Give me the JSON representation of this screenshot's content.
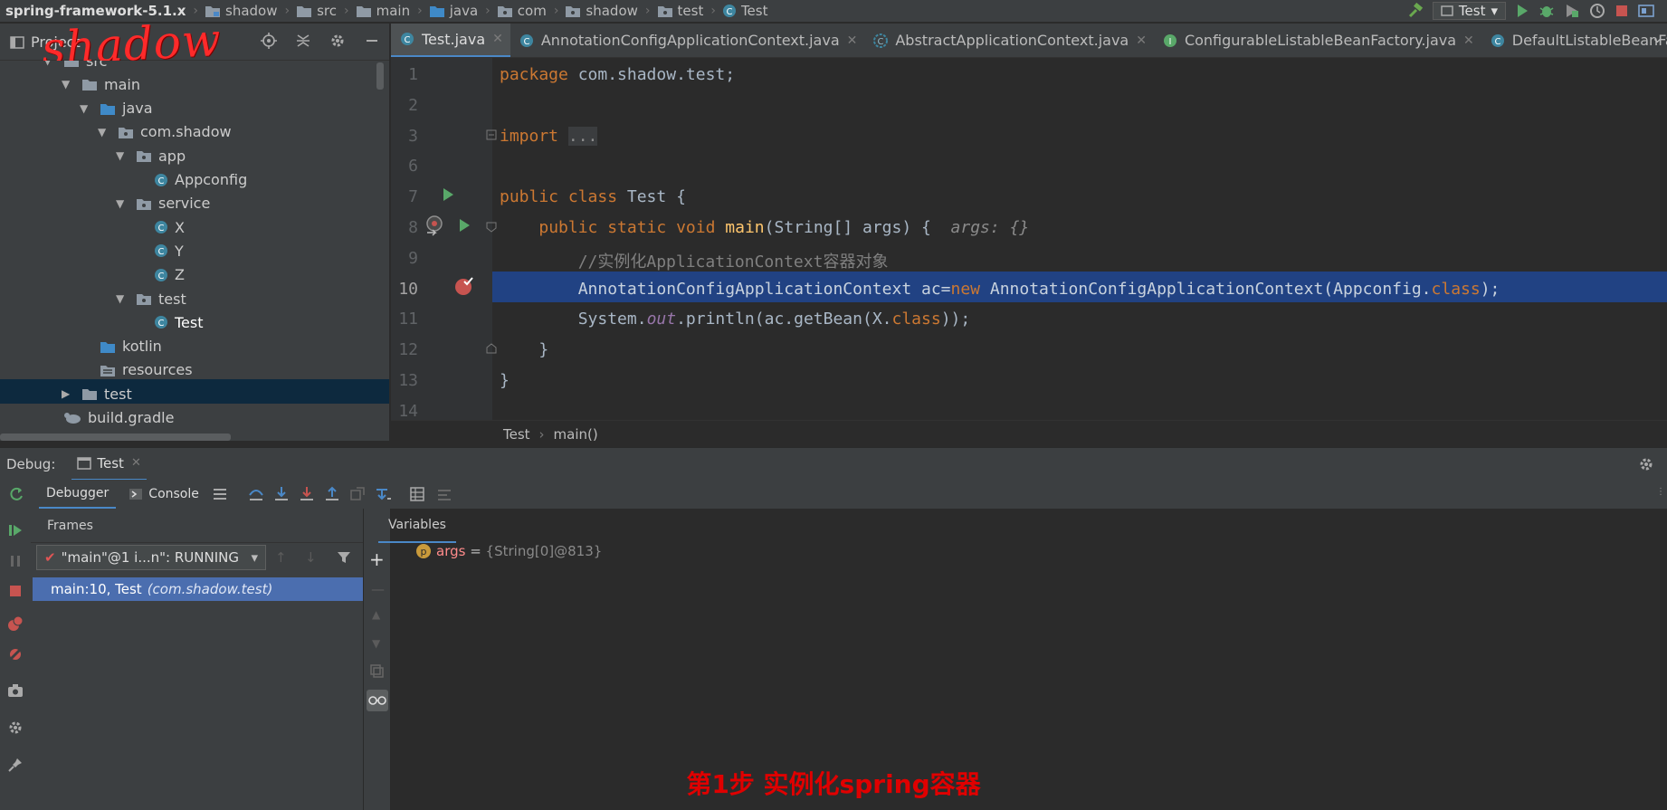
{
  "breadcrumb": [
    {
      "label": "spring-framework-5.1.x",
      "icon": "none"
    },
    {
      "label": "shadow",
      "icon": "module-folder-icon"
    },
    {
      "label": "src",
      "icon": "folder-icon"
    },
    {
      "label": "main",
      "icon": "folder-icon"
    },
    {
      "label": "java",
      "icon": "source-folder-icon"
    },
    {
      "label": "com",
      "icon": "package-icon"
    },
    {
      "label": "shadow",
      "icon": "package-icon"
    },
    {
      "label": "test",
      "icon": "package-icon"
    },
    {
      "label": "Test",
      "icon": "class-icon"
    }
  ],
  "run_config": {
    "label": "Test"
  },
  "project_panel": {
    "title": "Project",
    "logo_text": "shadow"
  },
  "tabs": [
    {
      "label": "Test.java",
      "icon": "class-icon",
      "active": true
    },
    {
      "label": "AnnotationConfigApplicationContext.java",
      "icon": "class-icon"
    },
    {
      "label": "AbstractApplicationContext.java",
      "icon": "abstract-class-icon"
    },
    {
      "label": "ConfigurableListableBeanFactory.java",
      "icon": "interface-icon"
    },
    {
      "label": "DefaultListableBeanFactory.java",
      "icon": "class-icon"
    }
  ],
  "tree": [
    {
      "label": "src",
      "depth": 0,
      "expanded": true,
      "icon": "folder-icon"
    },
    {
      "label": "main",
      "depth": 1,
      "expanded": true,
      "icon": "folder-icon"
    },
    {
      "label": "java",
      "depth": 2,
      "expanded": true,
      "icon": "source-folder-icon"
    },
    {
      "label": "com.shadow",
      "depth": 3,
      "expanded": true,
      "icon": "package-icon"
    },
    {
      "label": "app",
      "depth": 4,
      "expanded": true,
      "icon": "package-icon"
    },
    {
      "label": "Appconfig",
      "depth": 5,
      "icon": "class-icon"
    },
    {
      "label": "service",
      "depth": 4,
      "expanded": true,
      "icon": "package-icon"
    },
    {
      "label": "X",
      "depth": 5,
      "icon": "class-icon"
    },
    {
      "label": "Y",
      "depth": 5,
      "icon": "class-icon"
    },
    {
      "label": "Z",
      "depth": 5,
      "icon": "class-icon"
    },
    {
      "label": "test",
      "depth": 4,
      "expanded": true,
      "icon": "package-icon"
    },
    {
      "label": "Test",
      "depth": 5,
      "icon": "class-icon",
      "selected": true
    },
    {
      "label": "kotlin",
      "depth": 2,
      "icon": "source-folder-icon"
    },
    {
      "label": "resources",
      "depth": 2,
      "icon": "resources-folder-icon"
    },
    {
      "label": "test",
      "depth": 1,
      "expanded": false,
      "icon": "folder-icon"
    },
    {
      "label": "build.gradle",
      "depth": 0,
      "icon": "gradle-icon"
    }
  ],
  "editor": {
    "lines": [
      {
        "num": "1",
        "html": "<span class=\"kw\">package</span> com.shadow.test;"
      },
      {
        "num": "2",
        "html": ""
      },
      {
        "num": "3",
        "html": "<span class=\"kw\">import</span> <span class=\"fold\">...</span>"
      },
      {
        "num": "6",
        "html": ""
      },
      {
        "num": "7",
        "html": "<span class=\"kw\">public class</span> Test {"
      },
      {
        "num": "8",
        "html": "    <span class=\"kw\">public static void</span> <span style=\"color:#ffc66d\">main</span>(String[] args) {  <span class=\"ph\">args: {}</span>"
      },
      {
        "num": "9",
        "html": "        <span class=\"cm\">//实例化ApplicationContext容器对象</span>"
      },
      {
        "num": "10",
        "html": "        AnnotationConfigApplicationContext ac=<span class=\"kw\">new</span> AnnotationConfigApplicationContext(Appconfig.<span class=\"kw\">class</span>);"
      },
      {
        "num": "11",
        "html": "        System.<span class=\"it\">out</span>.println(ac.getBean(X.<span class=\"kw\">class</span>));"
      },
      {
        "num": "12",
        "html": "    }"
      },
      {
        "num": "13",
        "html": "}"
      },
      {
        "num": "14",
        "html": ""
      }
    ],
    "current_line": "10",
    "crumb": [
      "Test",
      "main()"
    ]
  },
  "debug": {
    "label": "Debug:",
    "session_tab": "Test",
    "tabs": {
      "debugger": "Debugger",
      "console": "Console"
    },
    "frames_title": "Frames",
    "variables_title": "Variables",
    "thread": "\"main\"@1 i...n\": RUNNING",
    "frame": {
      "location": "main:10, Test",
      "package": "(com.shadow.test)"
    },
    "variable": {
      "name": "args",
      "eq": " = ",
      "value": "{String[0]@813}"
    }
  },
  "caption": "第1步 实例化spring容器",
  "colors": {
    "accent": "#4a88c7",
    "selection": "#214283",
    "frame_selected": "#4b6eaf",
    "caption": "#e00000"
  }
}
